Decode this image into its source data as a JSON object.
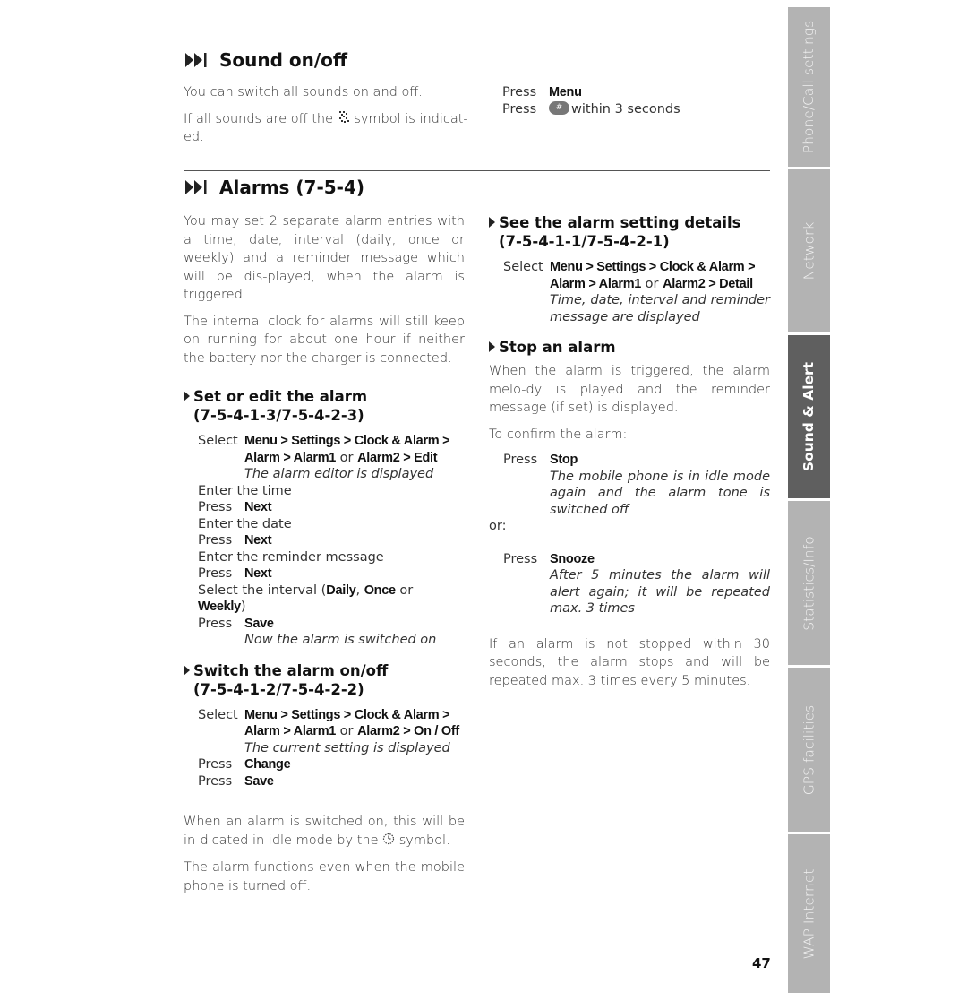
{
  "sound": {
    "title": "Sound on/off",
    "p1": "You can switch all sounds on and off.",
    "p2_a": "If all sounds are off the",
    "p2_b": "symbol is indicat-ed.",
    "press1_label": "Press",
    "press1_key": "Menu",
    "press2_label": "Press",
    "press2_key": "#",
    "press2_text": "within 3 seconds"
  },
  "alarms": {
    "title": "Alarms (7-5-4)",
    "intro1": "You may set 2 separate alarm entries with a time, date, interval (daily, once or weekly) and a reminder message which will be dis-played, when the alarm is triggered.",
    "intro2": "The internal clock for alarms will still keep on running for about one hour if neither the battery nor the charger is connected.",
    "set_edit": {
      "heading1": "Set or edit the alarm",
      "heading2": "(7-5-4-1-3/7-5-4-2-3)",
      "select_label": "Select",
      "path1": "Menu > Settings > Clock & Alarm >",
      "path2a": "Alarm > Alarm1",
      "or": "or",
      "path2b": "Alarm2 > Edit",
      "note": "The alarm editor is displayed",
      "enter_time": "Enter the time",
      "press": "Press",
      "next": "Next",
      "enter_date": "Enter the date",
      "enter_msg": "Enter the reminder message",
      "interval_a": "Select the interval (",
      "daily": "Daily",
      "comma": ", ",
      "once": "Once",
      "or2": " or ",
      "weekly": "Weekly",
      "close": ")",
      "save": "Save",
      "done": "Now the alarm is switched on"
    },
    "switch": {
      "heading1": "Switch the alarm on/off",
      "heading2": "(7-5-4-1-2/7-5-4-2-2)",
      "select_label": "Select",
      "path1": "Menu > Settings > Clock & Alarm >",
      "path2a": "Alarm > Alarm1",
      "or": "or",
      "path2b": "Alarm2 > On / Off",
      "note": "The current setting is displayed",
      "press": "Press",
      "change": "Change",
      "save": "Save"
    },
    "outro1_a": "When an alarm is switched on, this will be in-dicated in idle mode by the",
    "outro1_b": "symbol.",
    "outro2": "The alarm functions even when the mobile phone is turned off.",
    "details": {
      "heading1": "See the alarm setting details",
      "heading2": "(7-5-4-1-1/7-5-4-2-1)",
      "select_label": "Select",
      "path1": "Menu > Settings > Clock & Alarm >",
      "path2a": "Alarm > Alarm1",
      "or": "or",
      "path2b": "Alarm2 > Detail",
      "note": "Time, date, interval and reminder message are displayed"
    },
    "stop": {
      "heading": "Stop an alarm",
      "p1": "When the alarm is triggered, the alarm melo-dy is played and the reminder message (if set) is displayed.",
      "p2": "To confirm the alarm:",
      "press": "Press",
      "stop_key": "Stop",
      "stop_note": "The mobile phone is in idle mode again and the alarm tone is switched off",
      "or": "or:",
      "snooze_key": "Snooze",
      "snooze_note": "After 5 minutes the alarm will alert again; it will be repeated max. 3 times",
      "p3": "If an alarm is not stopped within 30 seconds, the alarm stops and will be repeated max. 3 times every 5 minutes."
    }
  },
  "page_number": "47",
  "tabs": [
    {
      "label": "Phone/Call settings",
      "active": false
    },
    {
      "label": "Network",
      "active": false
    },
    {
      "label": "Sound & Alert",
      "active": true
    },
    {
      "label": "Statistics/Info",
      "active": false
    },
    {
      "label": "GPS facilities",
      "active": false
    },
    {
      "label": "WAP Internet",
      "active": false
    }
  ]
}
